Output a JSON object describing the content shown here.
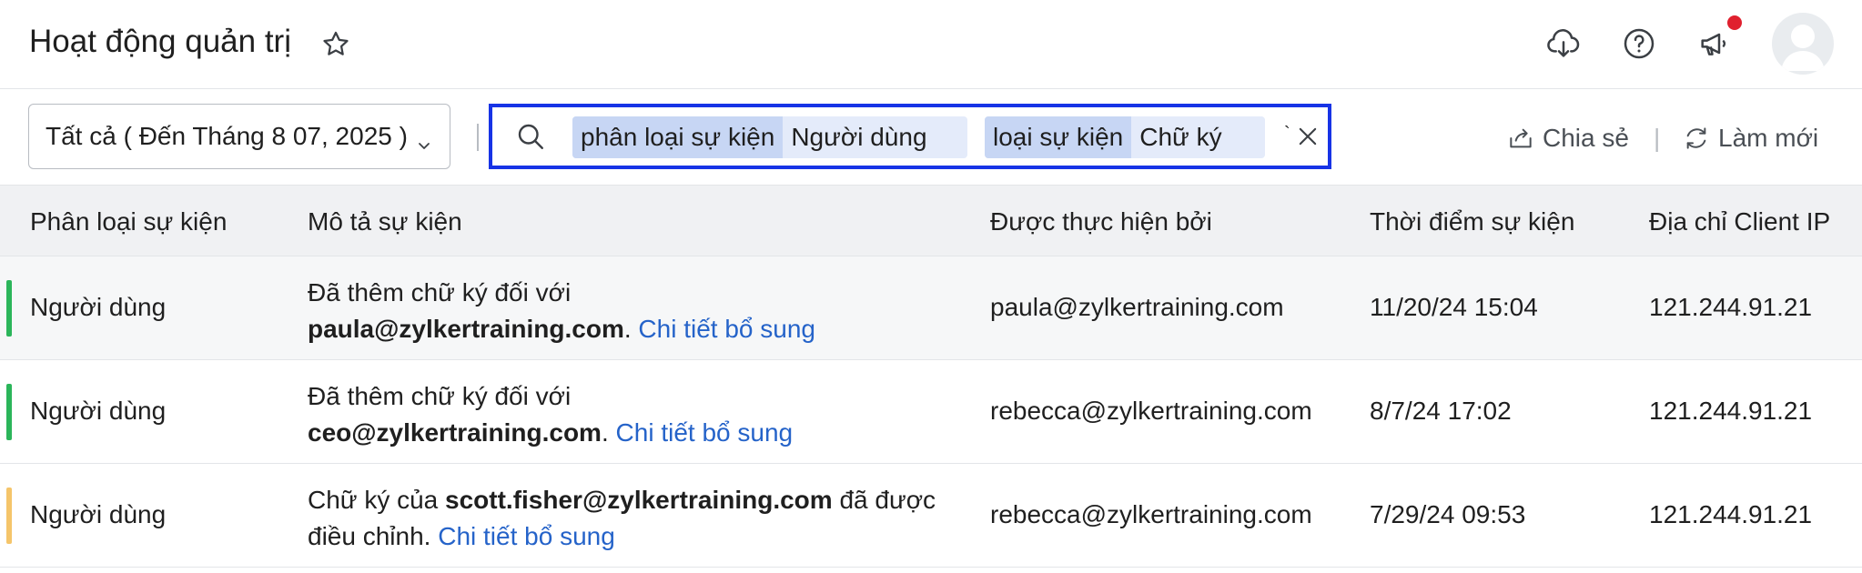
{
  "header": {
    "title": "Hoạt động quản trị",
    "icons": [
      "star-icon",
      "cloud-download-icon",
      "help-icon",
      "megaphone-icon",
      "user-avatar"
    ],
    "notification_dot_color": "#e0202e"
  },
  "toolbar": {
    "date_filter": "Tất cả ( Đến Tháng 8 07, 2025 )",
    "search": {
      "chips": [
        {
          "key": "phân loại sự kiện",
          "value": "Người dùng"
        },
        {
          "key": "loại sự kiện",
          "value": "Chữ ký"
        }
      ],
      "tick": "`"
    },
    "share_label": "Chia sẻ",
    "separator": "|",
    "refresh_label": "Làm mới"
  },
  "table": {
    "columns": [
      "Phân loại sự kiện",
      "Mô tả sự kiện",
      "Được thực hiện bởi",
      "Thời điểm sự kiện",
      "Địa chỉ Client IP"
    ],
    "rows": [
      {
        "category": "Người dùng",
        "bar_color": "#2bb55a",
        "desc_prefix": "Đã thêm chữ ký đối với",
        "desc_bold": "paula@zylkertraining.com",
        "desc_suffix": ".",
        "link": "Chi tiết bổ sung",
        "by": "paula@zylkertraining.com",
        "time": "11/20/24 15:04",
        "ip": "121.244.91.21"
      },
      {
        "category": "Người dùng",
        "bar_color": "#2bb55a",
        "desc_prefix": "Đã thêm chữ ký đối với",
        "desc_bold": "ceo@zylkertraining.com",
        "desc_suffix": ".",
        "link": "Chi tiết bổ sung",
        "by": "rebecca@zylkertraining.com",
        "time": "8/7/24 17:02",
        "ip": "121.244.91.21"
      },
      {
        "category": "Người dùng",
        "bar_color": "#f5c56a",
        "desc_prefix": "Chữ ký của",
        "desc_bold": "scott.fisher@zylkertraining.com",
        "desc_suffix": "đã được",
        "desc_line2": "điều chỉnh.",
        "link": "Chi tiết bổ sung",
        "by": "rebecca@zylkertraining.com",
        "time": "7/29/24 09:53",
        "ip": "121.244.91.21"
      }
    ]
  }
}
